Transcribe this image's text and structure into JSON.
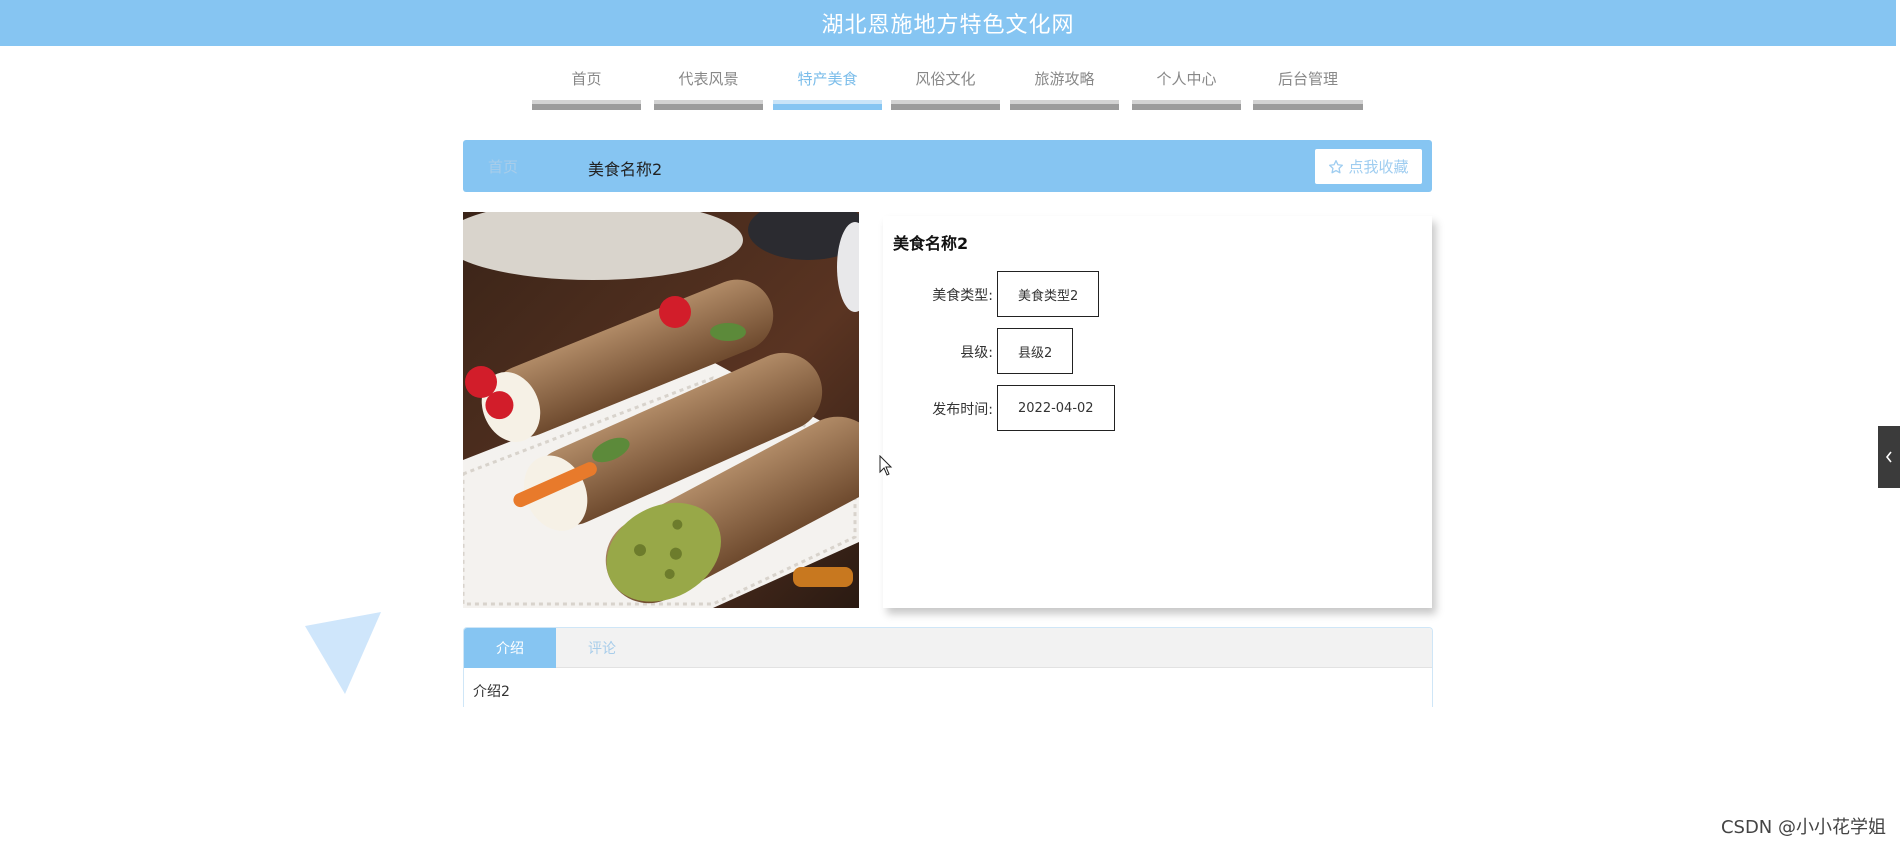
{
  "header": {
    "site_title": "湖北恩施地方特色文化网"
  },
  "nav": {
    "items": [
      {
        "label": "首页",
        "active": false
      },
      {
        "label": "代表风景",
        "active": false
      },
      {
        "label": "特产美食",
        "active": true
      },
      {
        "label": "风俗文化",
        "active": false
      },
      {
        "label": "旅游攻略",
        "active": false
      },
      {
        "label": "个人中心",
        "active": false
      },
      {
        "label": "后台管理",
        "active": false
      }
    ]
  },
  "breadcrumb": {
    "home": "首页",
    "current": "美食名称2"
  },
  "favorite": {
    "icon": "star-outline-icon",
    "label": "点我收藏"
  },
  "detail": {
    "title": "美食名称2",
    "fields": [
      {
        "label": "美食类型:",
        "value": "美食类型2"
      },
      {
        "label": "县级:",
        "value": "县级2"
      },
      {
        "label": "发布时间:",
        "value": "2022-04-02"
      }
    ]
  },
  "tabs": {
    "items": [
      {
        "label": "介绍",
        "active": true
      },
      {
        "label": "评论",
        "active": false
      }
    ],
    "content": "介绍2"
  },
  "side_handle": {
    "icon": "chevron-left-icon"
  },
  "watermark": "CSDN @小小花学姐",
  "colors": {
    "accent": "#86c5f2",
    "nav_bar": "#9b9b9b",
    "text": "#333333"
  }
}
